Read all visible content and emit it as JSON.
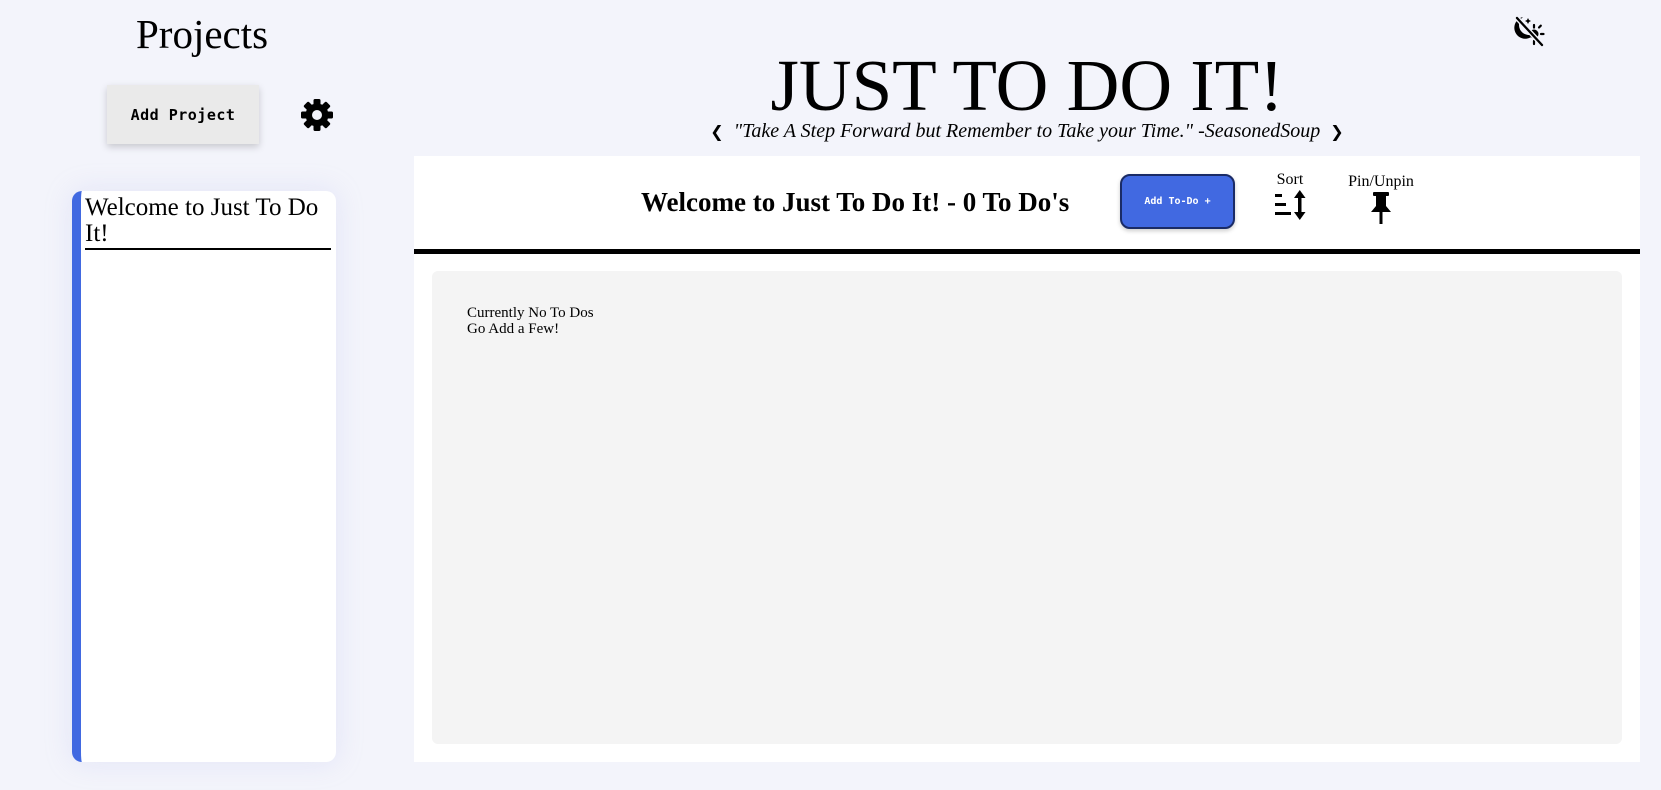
{
  "sidebar": {
    "title": "Projects",
    "add_project_label": "Add Project",
    "settings_icon": "gear-icon",
    "projects": [
      {
        "label": "Welcome to Just To Do It!",
        "accent_color": "#4169e1"
      }
    ]
  },
  "header": {
    "title": "JUST TO DO IT!",
    "quote": "\"Take A Step Forward but Remember to Take your Time.\" -SeasonedSoup",
    "prev_quote": "❮",
    "next_quote": "❯",
    "theme_toggle_icon": "moon-sun-toggle-icon"
  },
  "main": {
    "heading": "Welcome to Just To Do It! - 0 To Do's",
    "add_todo_label": "Add To-Do +",
    "sort_label": "Sort",
    "pin_label": "Pin/Unpin",
    "empty_line1": "Currently No To Dos",
    "empty_line2": "Go Add a Few!"
  },
  "colors": {
    "accent": "#4169e1",
    "page_background": "#f3f4fb",
    "panel_background": "#ffffff",
    "todo_area_background": "#f4f4f4"
  }
}
